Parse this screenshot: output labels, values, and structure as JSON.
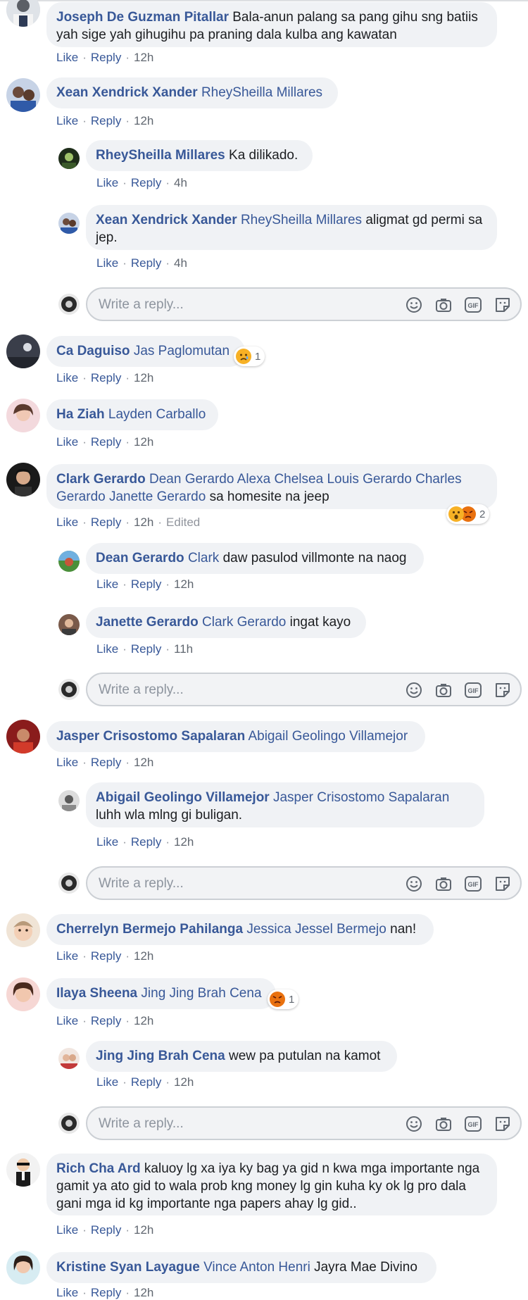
{
  "reply_placeholder": "Write a reply...",
  "labels": {
    "like": "Like",
    "reply": "Reply",
    "edited": "Edited"
  },
  "comments": [
    {
      "id": "c1",
      "name": "Joseph De Guzman Pitallar",
      "text": "Bala-anun palang sa pang gihu sng batiis yah sige yah gihugihu pa praning dala kulba ang kawatan",
      "time": "12h"
    },
    {
      "id": "c2",
      "name": "Xean Xendrick Xander",
      "tags": "RheySheilla Millares",
      "time": "12h",
      "replies": [
        {
          "name": "RheySheilla Millares",
          "text": "Ka dilikado.",
          "time": "4h"
        },
        {
          "name": "Xean Xendrick Xander",
          "tags": "RheySheilla Millares",
          "text": "aligmat gd permi sa jep.",
          "time": "4h"
        }
      ]
    },
    {
      "id": "c3",
      "name": "Ca Daguiso",
      "tags": "Jas Paglomutan",
      "time": "12h",
      "reaction_count": "1",
      "reaction": "sad"
    },
    {
      "id": "c4",
      "name": "Ha Ziah",
      "tags": "Layden Carballo",
      "time": "12h"
    },
    {
      "id": "c5",
      "name": "Clark Gerardo",
      "tags": "Dean Gerardo Alexa Chelsea Louis Gerardo Charles Gerardo Janette Gerardo",
      "text": "sa homesite na jeep",
      "time": "12h",
      "reaction_count": "2",
      "reactions": [
        "wow",
        "angry"
      ],
      "replies": [
        {
          "name": "Dean Gerardo",
          "tags": "Clark",
          "text": "daw pasulod villmonte na naog",
          "time": "12h"
        },
        {
          "name": "Janette Gerardo",
          "tags": "Clark Gerardo",
          "text": "ingat kayo",
          "time": "11h"
        }
      ]
    },
    {
      "id": "c6",
      "name": "Jasper Crisostomo Sapalaran",
      "tags": "Abigail Geolingo Villamejor",
      "time": "12h",
      "replies": [
        {
          "name": "Abigail Geolingo Villamejor",
          "tags": "Jasper Crisostomo Sapalaran",
          "text": "luhh wla mlng gi buligan.",
          "time": "12h"
        }
      ]
    },
    {
      "id": "c7",
      "name": "Cherrelyn Bermejo Pahilanga",
      "tags": "Jessica Jessel Bermejo",
      "text": "nan!",
      "time": "12h"
    },
    {
      "id": "c8",
      "name": "Ilaya Sheena",
      "tags": "Jing Jing Brah Cena",
      "time": "12h",
      "reaction_count": "1",
      "reaction": "angry",
      "replies": [
        {
          "name": "Jing Jing Brah Cena",
          "text": "wew pa putulan na kamot",
          "time": "12h"
        }
      ]
    },
    {
      "id": "c9",
      "name": "Rich Cha Ard",
      "text": "kaluoy lg xa iya ky bag ya gid n kwa mga importante nga gamit ya ato gid to wala prob kng money lg gin kuha ky ok lg pro dala gani mga id kg importante nga papers ahay lg gid..",
      "time": "12h"
    },
    {
      "id": "c10",
      "name": "Kristine Syan Layague",
      "tags": "Vince Anton Henri",
      "text": "Jayra Mae Divino",
      "time": "12h"
    }
  ],
  "colors": {
    "link": "#385898",
    "bubble": "#f0f2f5",
    "meta": "#606770",
    "angry": "#e9710f",
    "haha": "#f7b125"
  },
  "icons": [
    "smiley-icon",
    "camera-icon",
    "gif-icon",
    "sticker-icon",
    "sad-reaction-icon",
    "wow-reaction-icon",
    "angry-reaction-icon"
  ]
}
